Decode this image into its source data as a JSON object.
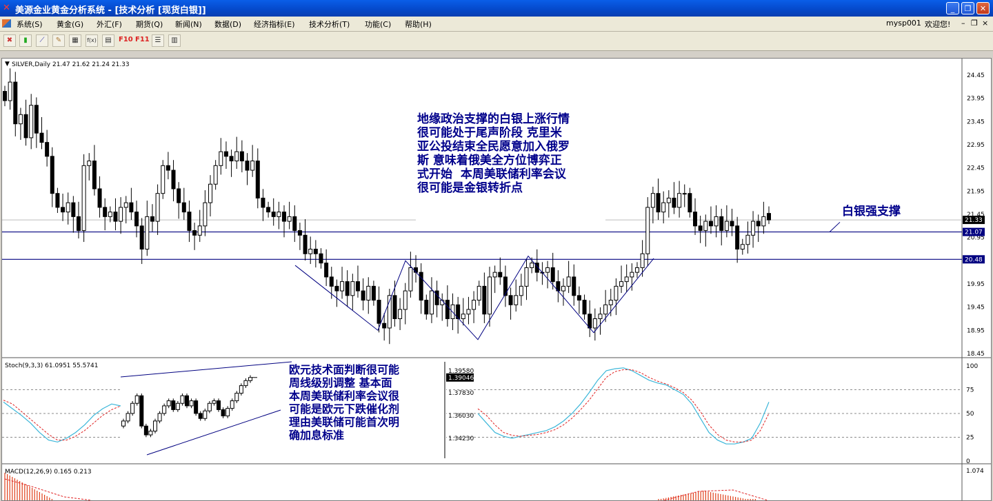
{
  "window": {
    "title": "美源金业黄金分析系统  -  [技术分析 [现货白银]]",
    "buttons": [
      "_",
      "❐",
      "✕"
    ]
  },
  "menubar": {
    "items": [
      "系统(S)",
      "黄金(G)",
      "外汇(F)",
      "期货(Q)",
      "新闻(N)",
      "数据(D)",
      "经济指标(E)",
      "技术分析(T)",
      "功能(C)",
      "帮助(H)"
    ],
    "user": "mysp001",
    "welcome": "欢迎您!",
    "controls": [
      "–",
      "❐",
      "×"
    ]
  },
  "toolbar": {
    "items": [
      {
        "icon": "close-chart-icon",
        "glyph": "✖"
      },
      {
        "icon": "candlestick-icon",
        "glyph": "▮"
      },
      {
        "icon": "line-chart-icon",
        "glyph": "⟋"
      },
      {
        "icon": "draw-icon",
        "glyph": "✎"
      },
      {
        "icon": "grid-icon",
        "glyph": "▦"
      },
      {
        "icon": "function-icon",
        "glyph": "f(x)"
      },
      {
        "icon": "print-icon",
        "glyph": "▤"
      },
      {
        "icon": "f10-icon",
        "glyph": "F10"
      },
      {
        "icon": "f11-icon",
        "glyph": "F11"
      },
      {
        "icon": "list-icon",
        "glyph": "☰"
      },
      {
        "icon": "table-icon",
        "glyph": "▥"
      }
    ]
  },
  "main_chart": {
    "header": "SILVER,Daily  21.47 21.62 21.24 21.33",
    "price_labels": [
      "24.45",
      "23.95",
      "23.45",
      "22.95",
      "22.45",
      "21.95",
      "21.45",
      "20.95",
      "20.45",
      "19.95",
      "19.45",
      "18.95",
      "18.45"
    ],
    "current_price": "21.33",
    "level_1": "21.07",
    "level_2": "20.48",
    "annotation": "地缘政治支撑的白银上涨行情\n很可能处于尾声阶段 克里米\n亚公投结束全民愿意加入俄罗\n斯 意味着俄美全方位博弈正\n式开始  本周美联储利率会议\n很可能是金银转折点",
    "support_label": "白银强支撑"
  },
  "stoch_panel": {
    "header": "Stoch(9,3,3) 61.0951 55.5741",
    "scale_labels": [
      "100",
      "75",
      "50",
      "25",
      "0"
    ],
    "inset_labels": [
      "1.39580",
      "1.39046",
      "1.37830",
      "1.36030",
      "1.34230"
    ],
    "annotation": "欧元技术面判断很可能\n周线级别调整 基本面\n本周美联储利率会议很\n可能是欧元下跌催化剂\n理由美联储可能首次明\n确加息标准"
  },
  "macd_panel": {
    "header": "MACD(12,26,9) 0.165 0.213",
    "scale_top": "1.074"
  },
  "colors": {
    "title_blue": "#0548c9",
    "annotation_text": "#00008b",
    "level_line": "#000080",
    "stoch_main": "#3ab6d9",
    "stoch_signal": "#e02020"
  },
  "chart_data": {
    "type": "candlestick",
    "symbol": "SILVER",
    "timeframe": "Daily",
    "ohlc_last": {
      "open": 21.47,
      "high": 21.62,
      "low": 21.24,
      "close": 21.33
    },
    "ylim": [
      18.45,
      24.45
    ],
    "horizontal_levels": [
      21.07,
      20.48
    ],
    "closes": [
      23.9,
      24.3,
      23.4,
      23.6,
      23.1,
      23.8,
      23.2,
      23.0,
      22.7,
      21.9,
      21.6,
      21.5,
      21.7,
      21.4,
      21.1,
      22.5,
      22.6,
      22.0,
      21.6,
      21.4,
      21.5,
      21.3,
      21.6,
      21.7,
      21.5,
      21.2,
      20.7,
      21.4,
      21.3,
      21.9,
      22.5,
      22.4,
      22.0,
      21.7,
      21.5,
      21.1,
      21.0,
      21.2,
      21.7,
      22.1,
      22.5,
      22.8,
      22.7,
      22.6,
      22.8,
      22.6,
      22.4,
      22.6,
      21.8,
      21.6,
      21.5,
      21.4,
      21.5,
      21.3,
      21.4,
      21.1,
      21.0,
      20.6,
      20.7,
      20.6,
      20.4,
      20.1,
      19.9,
      19.8,
      20.0,
      19.7,
      20.0,
      19.8,
      19.6,
      19.9,
      19.6,
      19.1,
      19.0,
      19.7,
      19.2,
      19.4,
      19.8,
      20.3,
      20.2,
      19.6,
      19.3,
      19.8,
      19.5,
      19.6,
      19.2,
      19.5,
      19.2,
      19.3,
      19.4,
      19.6,
      19.9,
      19.3,
      20.1,
      20.2,
      20.1,
      19.7,
      19.5,
      19.7,
      19.9,
      20.3,
      20.4,
      20.2,
      20.2,
      20.3,
      20.0,
      19.8,
      19.9,
      20.1,
      19.7,
      19.6,
      19.3,
      19.0,
      19.2,
      19.3,
      19.5,
      19.6,
      19.9,
      20.0,
      20.1,
      20.2,
      20.3,
      20.6,
      21.6,
      21.9,
      21.5,
      21.7,
      21.8,
      21.6,
      21.9,
      21.9,
      21.5,
      21.2,
      21.1,
      21.3,
      21.2,
      21.4,
      21.1,
      21.3,
      21.2,
      20.7,
      20.8,
      21.0,
      21.3,
      21.2,
      21.4,
      21.33
    ],
    "stoch_k": [
      62,
      55,
      48,
      40,
      30,
      22,
      20,
      24,
      30,
      38,
      48,
      55,
      60,
      58,
      50,
      40,
      30,
      26,
      24,
      26,
      28,
      30,
      32,
      36,
      42,
      50,
      60,
      72,
      85,
      95,
      97,
      98,
      95,
      90,
      85,
      82,
      80,
      75,
      70,
      60,
      45,
      30,
      22,
      18,
      18,
      20,
      24,
      40,
      62
    ],
    "stoch_signal": [
      64,
      60,
      52,
      44,
      36,
      28,
      22,
      22,
      26,
      32,
      40,
      48,
      54,
      58,
      55,
      48,
      38,
      30,
      27,
      26,
      27,
      28,
      30,
      33,
      38,
      45,
      54,
      64,
      76,
      88,
      94,
      96,
      96,
      93,
      88,
      84,
      81,
      77,
      72,
      64,
      52,
      38,
      28,
      22,
      20,
      20,
      22,
      32,
      50
    ]
  }
}
